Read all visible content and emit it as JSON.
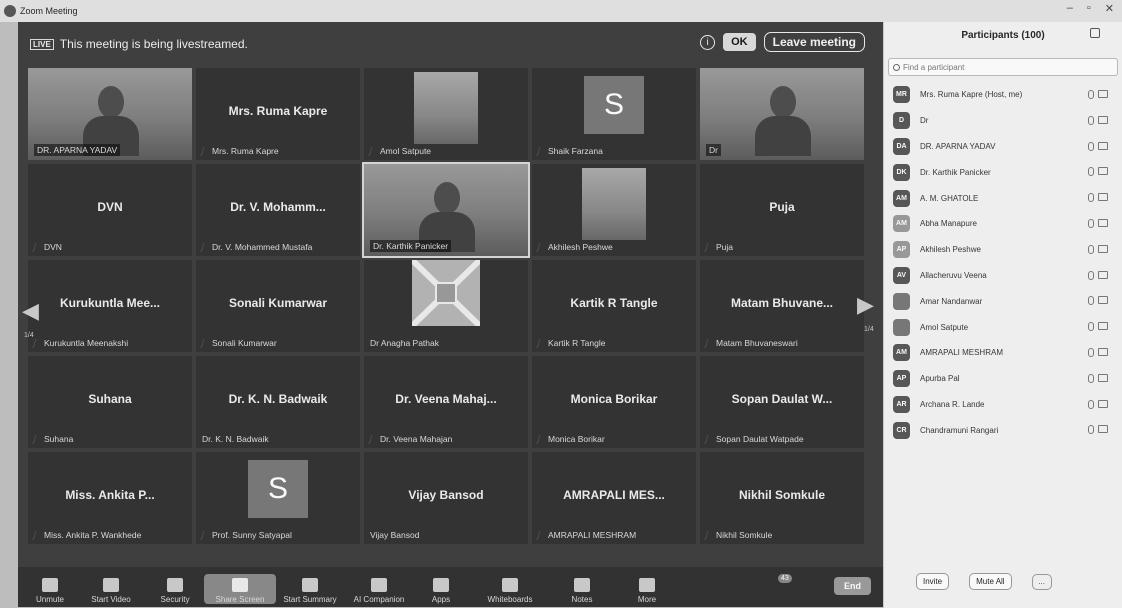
{
  "window": {
    "title": "Zoom Meeting"
  },
  "banner": {
    "live_badge": "LIVE",
    "message": "This meeting is being livestreamed.",
    "ok_label": "OK",
    "leave_label": "Leave meeting"
  },
  "page": {
    "current": "1/4"
  },
  "tiles": [
    {
      "center": "",
      "label": "DR. APARNA YADAV",
      "kind": "photo",
      "muted": false
    },
    {
      "center": "Mrs. Ruma Kapre",
      "label": "Mrs. Ruma Kapre",
      "kind": "name",
      "muted": true
    },
    {
      "center": "",
      "label": "Amol Satpute",
      "kind": "inset",
      "muted": true
    },
    {
      "center": "",
      "label": "Shaik Farzana",
      "kind": "letter",
      "letter": "S",
      "muted": true
    },
    {
      "center": "",
      "label": "Dr",
      "kind": "photo",
      "muted": false
    },
    {
      "center": "DVN",
      "label": "DVN",
      "kind": "name",
      "muted": true
    },
    {
      "center": "Dr. V. Mohamm...",
      "label": "Dr. V. Mohammed Mustafa",
      "kind": "name",
      "muted": true
    },
    {
      "center": "",
      "label": "Dr. Karthik Panicker",
      "kind": "photo",
      "muted": false,
      "active": true
    },
    {
      "center": "",
      "label": "Akhilesh Peshwe",
      "kind": "inset",
      "muted": true
    },
    {
      "center": "Puja",
      "label": "Puja",
      "kind": "name",
      "muted": true
    },
    {
      "center": "Kurukuntla Mee...",
      "label": "Kurukuntla Meenakshi",
      "kind": "name",
      "muted": true
    },
    {
      "center": "Sonali Kumarwar",
      "label": "Sonali Kumarwar",
      "kind": "name",
      "muted": true
    },
    {
      "center": "",
      "label": "Dr Anagha Pathak",
      "kind": "logo",
      "muted": false
    },
    {
      "center": "Kartik R Tangle",
      "label": "Kartik R Tangle",
      "kind": "name",
      "muted": true
    },
    {
      "center": "Matam  Bhuvane...",
      "label": "Matam Bhuvaneswari",
      "kind": "name",
      "muted": true
    },
    {
      "center": "Suhana",
      "label": "Suhana",
      "kind": "name",
      "muted": true
    },
    {
      "center": "Dr. K. N. Badwaik",
      "label": "Dr. K. N. Badwaik",
      "kind": "name",
      "muted": false
    },
    {
      "center": "Dr. Veena Mahaj...",
      "label": "Dr. Veena Mahajan",
      "kind": "name",
      "muted": true
    },
    {
      "center": "Monica Borikar",
      "label": "Monica Borikar",
      "kind": "name",
      "muted": true
    },
    {
      "center": "Sopan Daulat W...",
      "label": "Sopan Daulat Watpade",
      "kind": "name",
      "muted": true
    },
    {
      "center": "Miss. Ankita P...",
      "label": "Miss. Ankita P. Wankhede",
      "kind": "name",
      "muted": true
    },
    {
      "center": "",
      "label": "Prof. Sunny Satyapal",
      "kind": "letter",
      "letter": "S",
      "muted": true
    },
    {
      "center": "Vijay Bansod",
      "label": "Vijay Bansod",
      "kind": "name",
      "muted": false
    },
    {
      "center": "AMRAPALI MES...",
      "label": "AMRAPALI MESHRAM",
      "kind": "name",
      "muted": true
    },
    {
      "center": "Nikhil Somkule",
      "label": "Nikhil Somkule",
      "kind": "name",
      "muted": true
    }
  ],
  "toolbar": {
    "items": [
      "Unmute",
      "Start Video",
      "Security",
      "Share Screen",
      "Start Summary",
      "AI Companion",
      "Apps",
      "Whiteboards",
      "Notes",
      "More"
    ],
    "more_badge": "43",
    "end_label": "End"
  },
  "participants": {
    "header": "Participants (100)",
    "search_placeholder": "Find a participant",
    "list": [
      {
        "initials": "MR",
        "name": "Mrs. Ruma Kapre (Host, me)"
      },
      {
        "initials": "D",
        "name": "Dr"
      },
      {
        "initials": "DA",
        "name": "DR. APARNA YADAV"
      },
      {
        "initials": "DK",
        "name": "Dr. Karthik Panicker"
      },
      {
        "initials": "AM",
        "name": "A. M. GHATOLE"
      },
      {
        "initials": "AM",
        "name": "Abha Manapure"
      },
      {
        "initials": "AP",
        "name": "Akhilesh Peshwe"
      },
      {
        "initials": "AV",
        "name": "Allacheruvu Veena"
      },
      {
        "initials": "",
        "name": "Amar Nandanwar"
      },
      {
        "initials": "",
        "name": "Amol Satpute"
      },
      {
        "initials": "AM",
        "name": "AMRAPALI MESHRAM"
      },
      {
        "initials": "AP",
        "name": "Apurba Pal"
      },
      {
        "initials": "AR",
        "name": "Archana R. Lande"
      },
      {
        "initials": "CR",
        "name": "Chandramuni Rangari"
      }
    ],
    "invite_label": "Invite",
    "mute_all_label": "Mute All",
    "more_label": "..."
  }
}
